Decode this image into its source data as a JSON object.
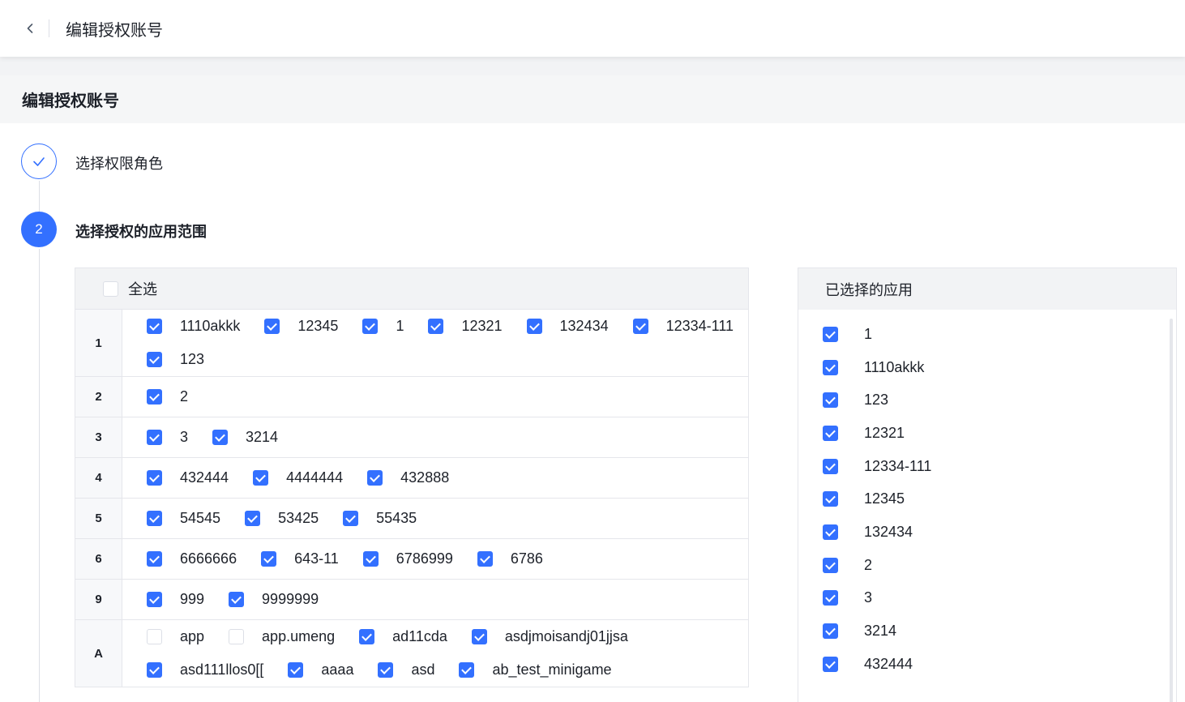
{
  "header": {
    "title": "编辑授权账号"
  },
  "page": {
    "title": "编辑授权账号"
  },
  "steps": [
    {
      "label": "选择权限角色",
      "state": "done"
    },
    {
      "label": "选择授权的应用范围",
      "number": "2",
      "state": "active"
    }
  ],
  "table": {
    "select_all": "全选",
    "rows": [
      {
        "key": "1",
        "lines": [
          [
            {
              "label": "1110akkk",
              "checked": true
            },
            {
              "label": "12345",
              "checked": true
            },
            {
              "label": "1",
              "checked": true
            },
            {
              "label": "12321",
              "checked": true
            },
            {
              "label": "132434",
              "checked": true
            },
            {
              "label": "12334-111",
              "checked": true
            }
          ],
          [
            {
              "label": "123",
              "checked": true
            }
          ]
        ]
      },
      {
        "key": "2",
        "lines": [
          [
            {
              "label": "2",
              "checked": true
            }
          ]
        ]
      },
      {
        "key": "3",
        "lines": [
          [
            {
              "label": "3",
              "checked": true
            },
            {
              "label": "3214",
              "checked": true
            }
          ]
        ]
      },
      {
        "key": "4",
        "lines": [
          [
            {
              "label": "432444",
              "checked": true
            },
            {
              "label": "4444444",
              "checked": true
            },
            {
              "label": "432888",
              "checked": true
            }
          ]
        ]
      },
      {
        "key": "5",
        "lines": [
          [
            {
              "label": "54545",
              "checked": true
            },
            {
              "label": "53425",
              "checked": true
            },
            {
              "label": "55435",
              "checked": true
            }
          ]
        ]
      },
      {
        "key": "6",
        "lines": [
          [
            {
              "label": "6666666",
              "checked": true
            },
            {
              "label": "643-11",
              "checked": true
            },
            {
              "label": "6786999",
              "checked": true
            },
            {
              "label": "6786",
              "checked": true
            }
          ]
        ]
      },
      {
        "key": "9",
        "lines": [
          [
            {
              "label": "999",
              "checked": true
            },
            {
              "label": "9999999",
              "checked": true
            }
          ]
        ]
      },
      {
        "key": "A",
        "lines": [
          [
            {
              "label": "app",
              "checked": false
            },
            {
              "label": "app.umeng",
              "checked": false
            },
            {
              "label": "ad11cda",
              "checked": true
            },
            {
              "label": "asdjmoisandj01jjsa",
              "checked": true
            }
          ],
          [
            {
              "label": "asd111llos0[[",
              "checked": true
            },
            {
              "label": "aaaa",
              "checked": true
            },
            {
              "label": "asd",
              "checked": true
            },
            {
              "label": "ab_test_minigame",
              "checked": true
            }
          ]
        ]
      }
    ]
  },
  "selected_panel": {
    "title": "已选择的应用",
    "items": [
      "1",
      "1110akkk",
      "123",
      "12321",
      "12334-111",
      "12345",
      "132434",
      "2",
      "3",
      "3214",
      "432444"
    ]
  },
  "colors": {
    "accent": "#3370ff",
    "border": "#e5e6eb",
    "header_bg": "#f2f3f5"
  },
  "icons": {
    "back": "chevron-left-icon",
    "done": "check-icon"
  }
}
